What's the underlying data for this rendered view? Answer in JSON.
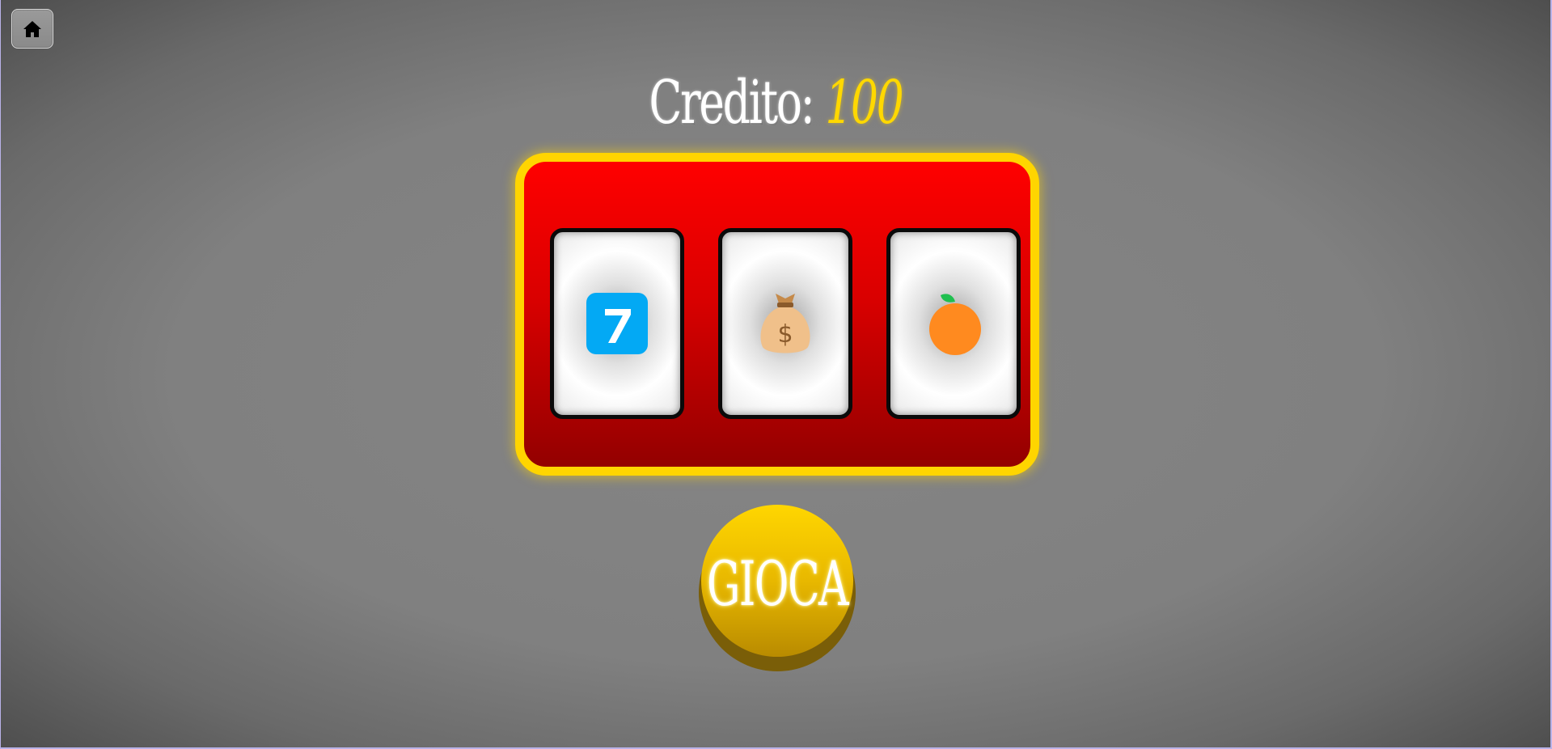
{
  "navigation": {
    "home_icon": "home-icon"
  },
  "header": {
    "credit_label": "Credito:",
    "credit_value": "100"
  },
  "reels": [
    {
      "symbol": "seven-keycap-icon",
      "color": "#03a9f4"
    },
    {
      "symbol": "money-bag-icon",
      "color": "#f0c08a"
    },
    {
      "symbol": "orange-fruit-icon",
      "color": "#ff8a1f"
    }
  ],
  "controls": {
    "play_label": "GIOCA"
  },
  "colors": {
    "frame_border": "#ffd500",
    "machine_red": "#ff0000",
    "credit_value": "#ffd800",
    "play_button": "#ffd600"
  }
}
